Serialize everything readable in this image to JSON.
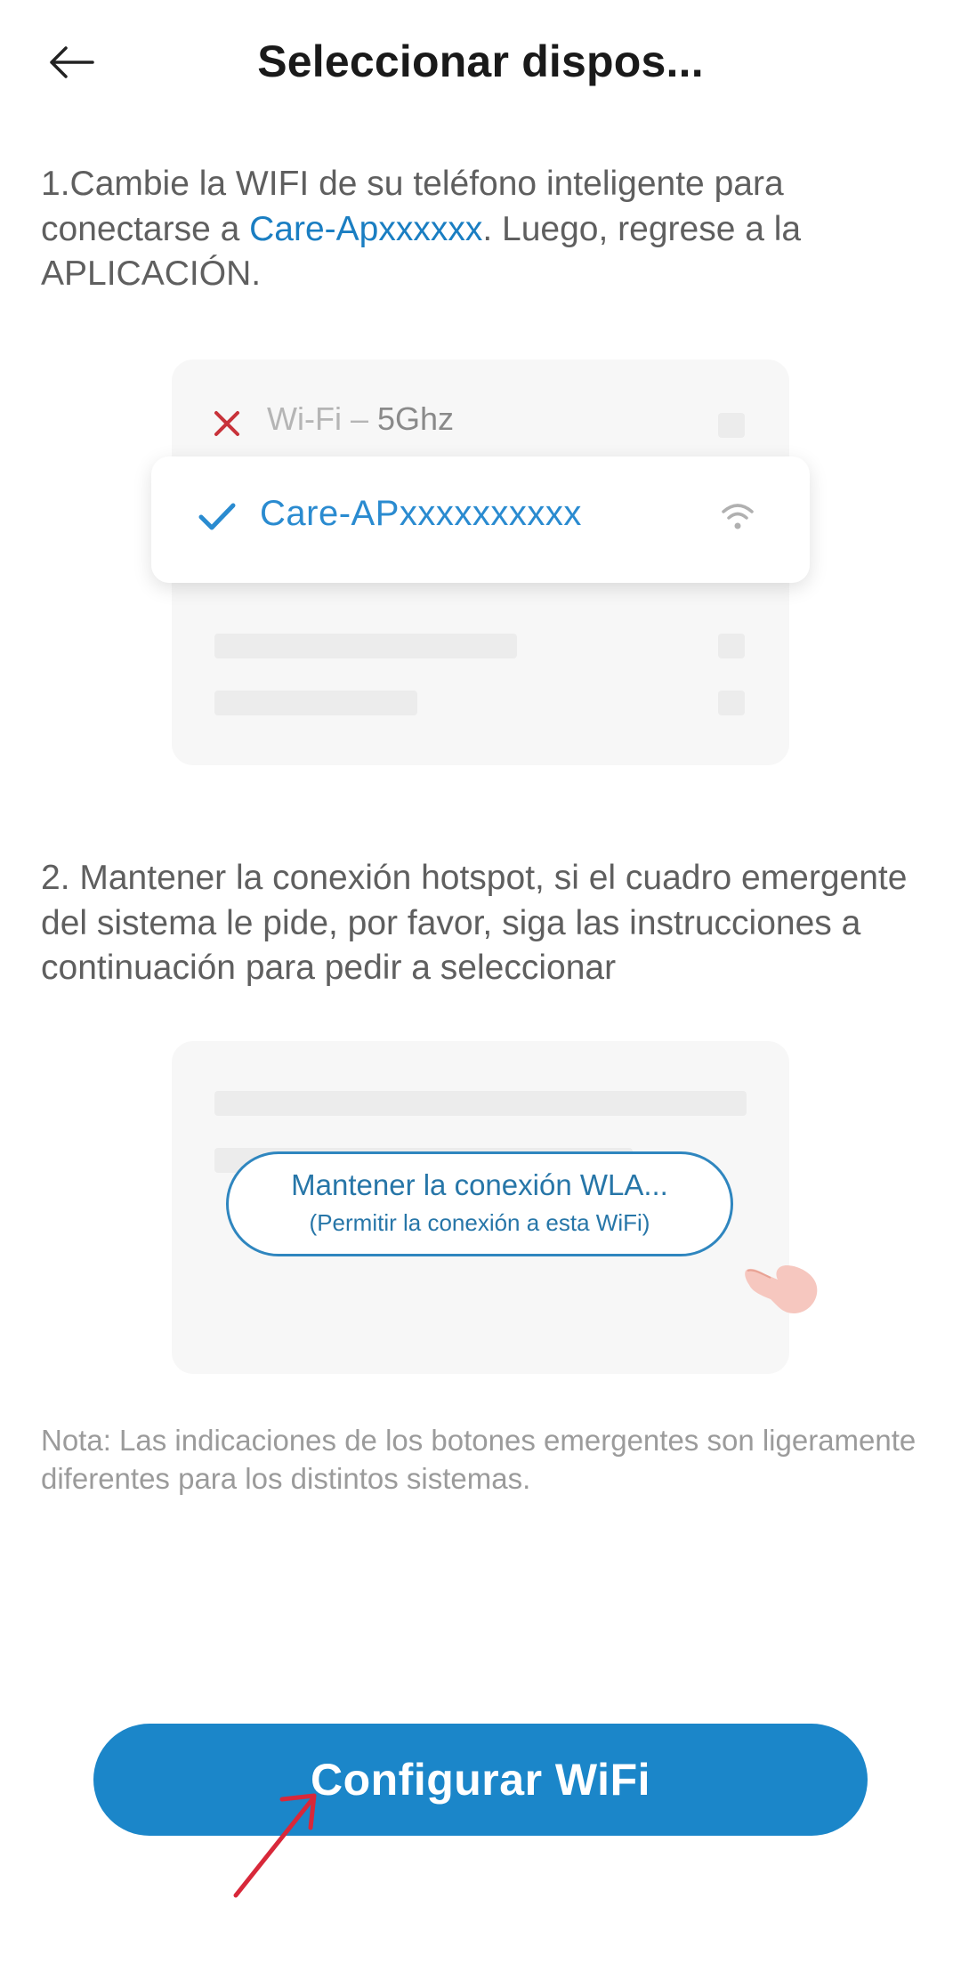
{
  "header": {
    "title": "Seleccionar dispos..."
  },
  "step1": {
    "text_before": "1.Cambie la WIFI de su teléfono inteligente para conectarse a ",
    "highlight": "Care-Apxxxxxx",
    "text_after": ". Luego, regrese a la APLICACIÓN."
  },
  "wifi_illustration": {
    "other_network_prefix": "Wi-Fi – ",
    "other_network_band": "5Ghz",
    "target_network": "Care-APxxxxxxxxxx"
  },
  "step2": {
    "text": "2. Mantener la conexión hotspot, si el cuadro emergente del sistema le pide, por favor, siga las instrucciones a continuación para pedir a seleccionar"
  },
  "popup_illustration": {
    "button_line1": "Mantener la conexión WLA...",
    "button_line2": "(Permitir la conexión a esta WiFi)"
  },
  "note": {
    "text": "Nota: Las indicaciones de los botones emergentes son ligeramente diferentes para los distintos sistemas."
  },
  "cta": {
    "label": "Configurar WiFi"
  },
  "colors": {
    "accent": "#1b86c9",
    "highlight_text": "#1a7ec2",
    "error_x": "#c8323a",
    "pointer_arrow": "#d8283a"
  },
  "icons": {
    "back": "arrow-left-icon",
    "error": "x-icon",
    "check": "check-icon",
    "signal": "wifi-signal-icon",
    "hand": "hand-pointer-icon",
    "arrow": "red-arrow-icon"
  }
}
